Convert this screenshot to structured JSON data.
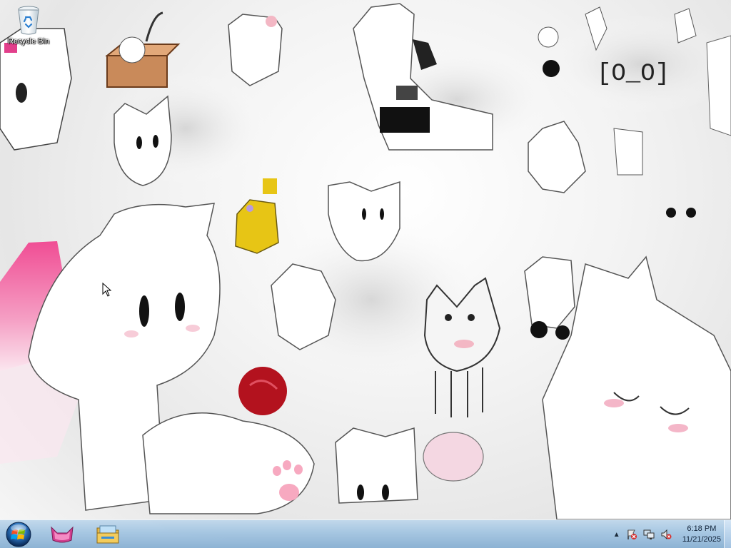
{
  "desktop": {
    "icons": [
      {
        "label": "Recycle Bin",
        "icon": "recycle-bin-icon"
      }
    ],
    "wallpaper_text": "[O_O]"
  },
  "taskbar": {
    "start": {
      "icon": "windows-orb-icon"
    },
    "pinned": [
      {
        "icon": "cat-ears-app-icon"
      },
      {
        "icon": "file-explorer-icon"
      }
    ],
    "tray": {
      "icons": [
        "show-hidden-icons-arrow",
        "action-center-flag-icon",
        "network-icon",
        "volume-muted-icon"
      ],
      "time": "6:18 PM",
      "date": "11/21/2025"
    }
  },
  "colors": {
    "taskbar": "#9fc0de",
    "accent_pink": "#ef4f95",
    "heart_red": "#b3121e",
    "yellow": "#e7c515"
  }
}
